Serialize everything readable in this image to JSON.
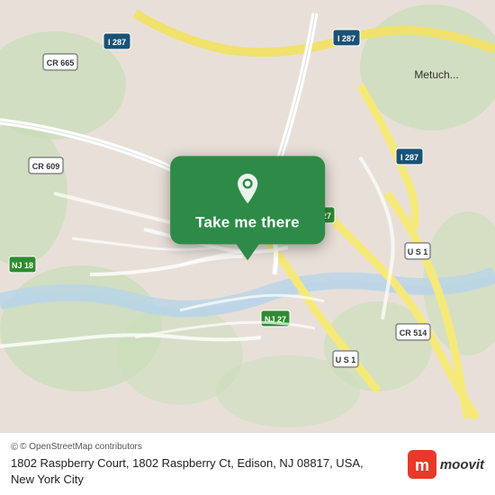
{
  "map": {
    "alt": "Map of Edison, NJ area showing 1802 Raspberry Court"
  },
  "popup": {
    "button_label": "Take me there"
  },
  "bottom_bar": {
    "osm_credit": "© OpenStreetMap contributors",
    "address": "1802 Raspberry Court, 1802 Raspberry Ct, Edison, NJ 08817, USA, New York City"
  },
  "branding": {
    "name": "moovit"
  },
  "colors": {
    "popup_green": "#2e8b47",
    "road_yellow": "#f5e97a",
    "road_white": "#ffffff",
    "map_bg": "#e8e0d8",
    "water": "#b8d4e8",
    "park": "#c8ddb8"
  }
}
